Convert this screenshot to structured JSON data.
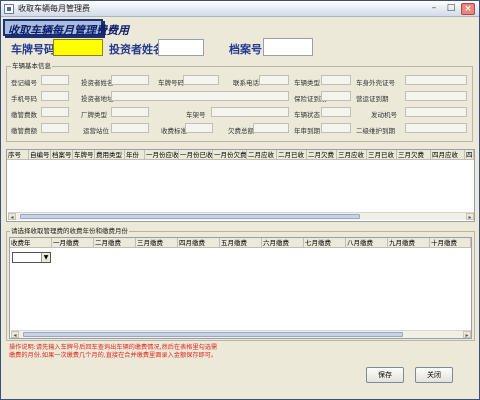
{
  "window": {
    "title": "收取车辆每月管理费"
  },
  "banner": {
    "text": "收取车辆每月管理费费用"
  },
  "form": {
    "plate_label": "车牌号码:",
    "plate_value": "",
    "investor_label": "投资者姓名:",
    "investor_value": "",
    "archive_label": "档案号:",
    "archive_value": ""
  },
  "basic_info": {
    "title": "车辆基本信息",
    "row1": [
      "登记编号",
      "投资者姓名",
      "车牌号码",
      "联系电话",
      "车辆类型",
      "车身外壳证号"
    ],
    "row2": [
      "手机号码",
      "投资者地址",
      "保险证到期",
      "营运证到期"
    ],
    "row3": [
      "缴管费数",
      "厂牌类型",
      "车架号",
      "车辆状态",
      "发动机号"
    ],
    "row4": [
      "缴管费额",
      "运营站位",
      "收费标准",
      "欠费总额",
      "年审到期",
      "二级维护到期"
    ]
  },
  "grid1": {
    "headers": [
      "序号",
      "自编号",
      "档案号",
      "车牌号",
      "费用类型",
      "年份",
      "一月份应收",
      "一月份已收",
      "一月份欠费",
      "二月应收",
      "二月已收",
      "二月欠费",
      "三月应收",
      "三月已收",
      "三月欠费",
      "四月应收",
      "四"
    ]
  },
  "year_section": {
    "title": "请选择收取管理费的收费年份和缴费月份",
    "headers": [
      "收费年",
      "一月缴费",
      "二月缴费",
      "三月缴费",
      "四月缴费",
      "五月缴费",
      "六月缴费",
      "七月缴费",
      "八月缴费",
      "九月缴费",
      "十月缴费"
    ],
    "year_value": ""
  },
  "hint": "操作说明:请先输入车牌号后回车查询出车辆的缴费情况,然后在表格里勾选需缴费的月份,如果一次缴费几个月的,直接在合并缴费里面录入金额保存即可。",
  "buttons": {
    "save": "保存",
    "close": "关闭"
  }
}
